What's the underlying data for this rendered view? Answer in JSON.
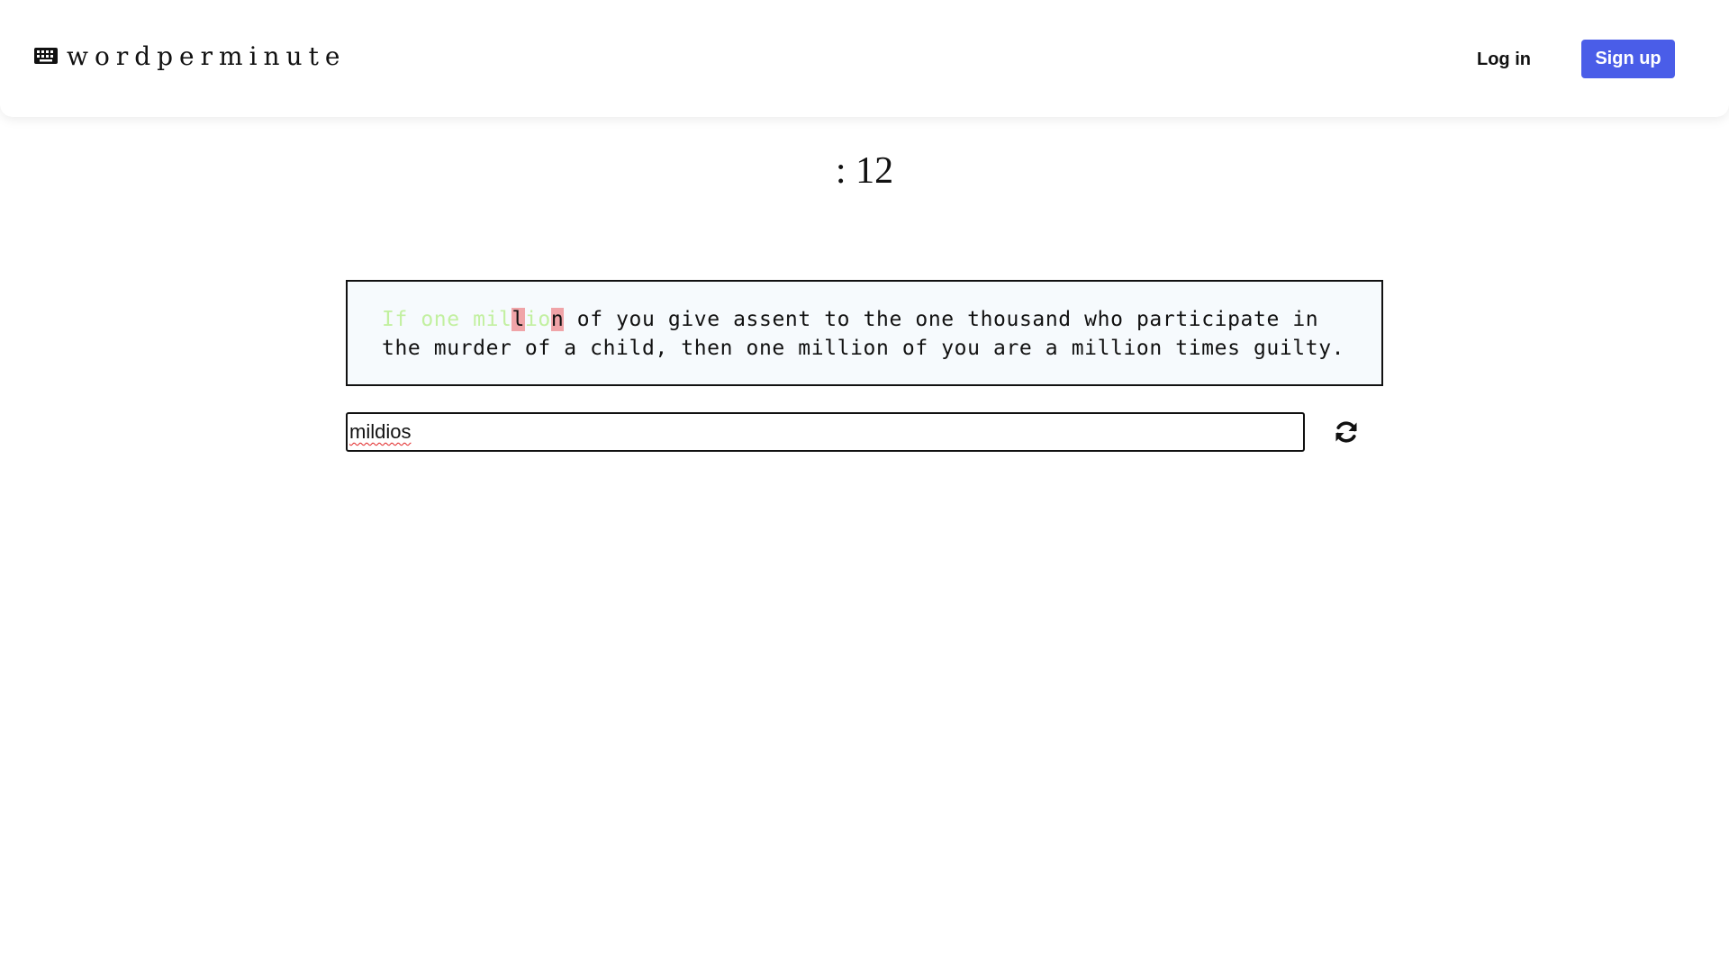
{
  "header": {
    "brand": "wordperminute",
    "brand_icon": "keyboard-icon",
    "login_label": "Log in",
    "signup_label": "Sign up",
    "signup_color": "#4a5de8"
  },
  "timer": {
    "text": ": 12"
  },
  "passage": {
    "typed_correct_1": "If one mil",
    "wrong_char_1": "l",
    "typed_correct_2": "io",
    "wrong_char_2": "n",
    "rest_line_1": " of you give assent to the one thousand who participate in",
    "line_2": "the murder of a child, then one million of you are a million times guilty.",
    "colors": {
      "correct": "#c2f0a0",
      "wrong_background": "#f0a4a8"
    }
  },
  "input": {
    "value": "mildios"
  },
  "reset": {
    "icon": "refresh-icon"
  }
}
